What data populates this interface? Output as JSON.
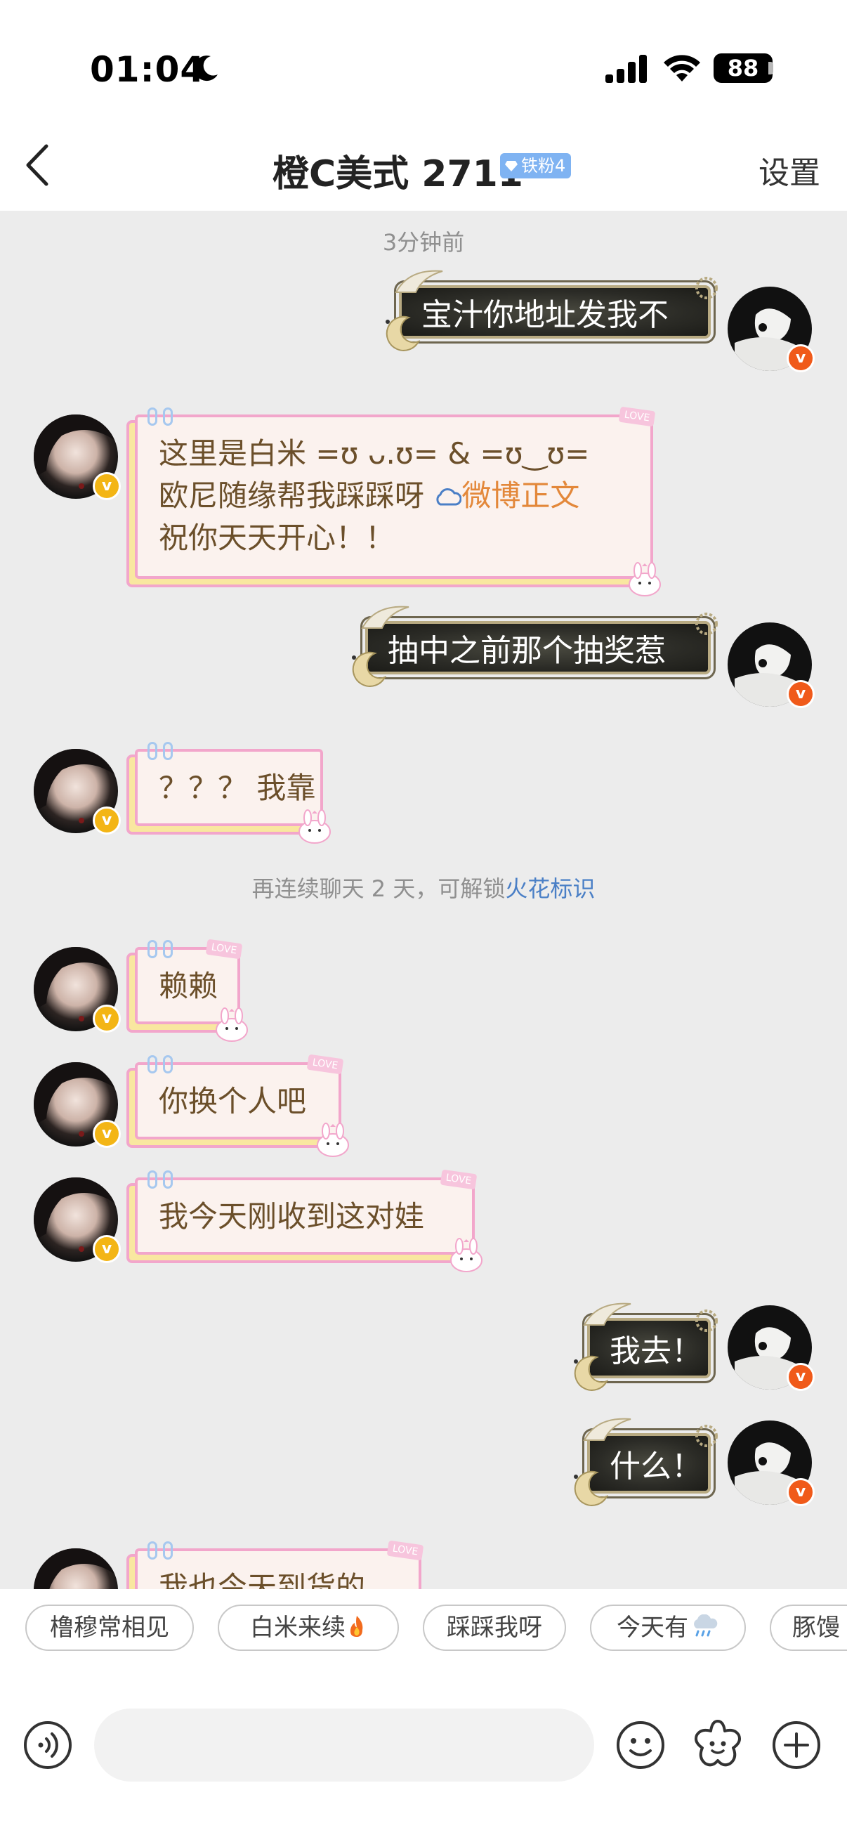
{
  "status_bar": {
    "time": "01:04",
    "battery": "88"
  },
  "header": {
    "title": "橙C美式 2711",
    "fan_badge": "铁粉4",
    "settings": "设置"
  },
  "chat": {
    "timestamp": "3分钟前",
    "messages": [
      {
        "side": "sent",
        "text": "宝汁你地址发我不"
      },
      {
        "side": "received",
        "lines": [
          "这里是白米  =ʊ ᴗ.ʊ= & =ʊ‿ʊ=",
          "欧尼随缘帮我踩踩呀 ",
          "祝你天天开心！！"
        ],
        "link": "微博正文"
      },
      {
        "side": "sent",
        "text": "抽中之前那个抽奖惹"
      },
      {
        "side": "received",
        "text": "？？？ 我靠"
      },
      {
        "side": "received",
        "text": "赖赖"
      },
      {
        "side": "received",
        "text": "你换个人吧"
      },
      {
        "side": "received",
        "text": "我今天刚收到这对娃"
      },
      {
        "side": "sent",
        "text": "我去！"
      },
      {
        "side": "sent",
        "text": "什么！"
      },
      {
        "side": "received",
        "text": "我也今天到货的"
      }
    ],
    "streak_notice": {
      "prefix": "再连续聊天 2 天，可解锁",
      "accent": "火花标识"
    }
  },
  "quick_replies": [
    "橹穆常相见",
    "白米来续",
    "踩踩我呀",
    "今天有",
    "豚馒"
  ],
  "input": {
    "placeholder": ""
  },
  "colors": {
    "accent_blue": "#4a7fc6",
    "link_orange": "#e3883a",
    "bubble_pink_border": "#f2a6cb",
    "bubble_dark_fill": "#2b2b26",
    "chat_bg": "#ececec",
    "verified_red": "#f05a1a",
    "verified_gold": "#f3b515"
  },
  "icons": [
    "back-icon",
    "moon-icon",
    "signal-icon",
    "wifi-icon",
    "diamond-icon",
    "voice-icon",
    "emoji-icon",
    "sticker-icon",
    "plus-icon",
    "fire-icon",
    "cloud-rain-icon",
    "weibo-cloud-icon"
  ]
}
